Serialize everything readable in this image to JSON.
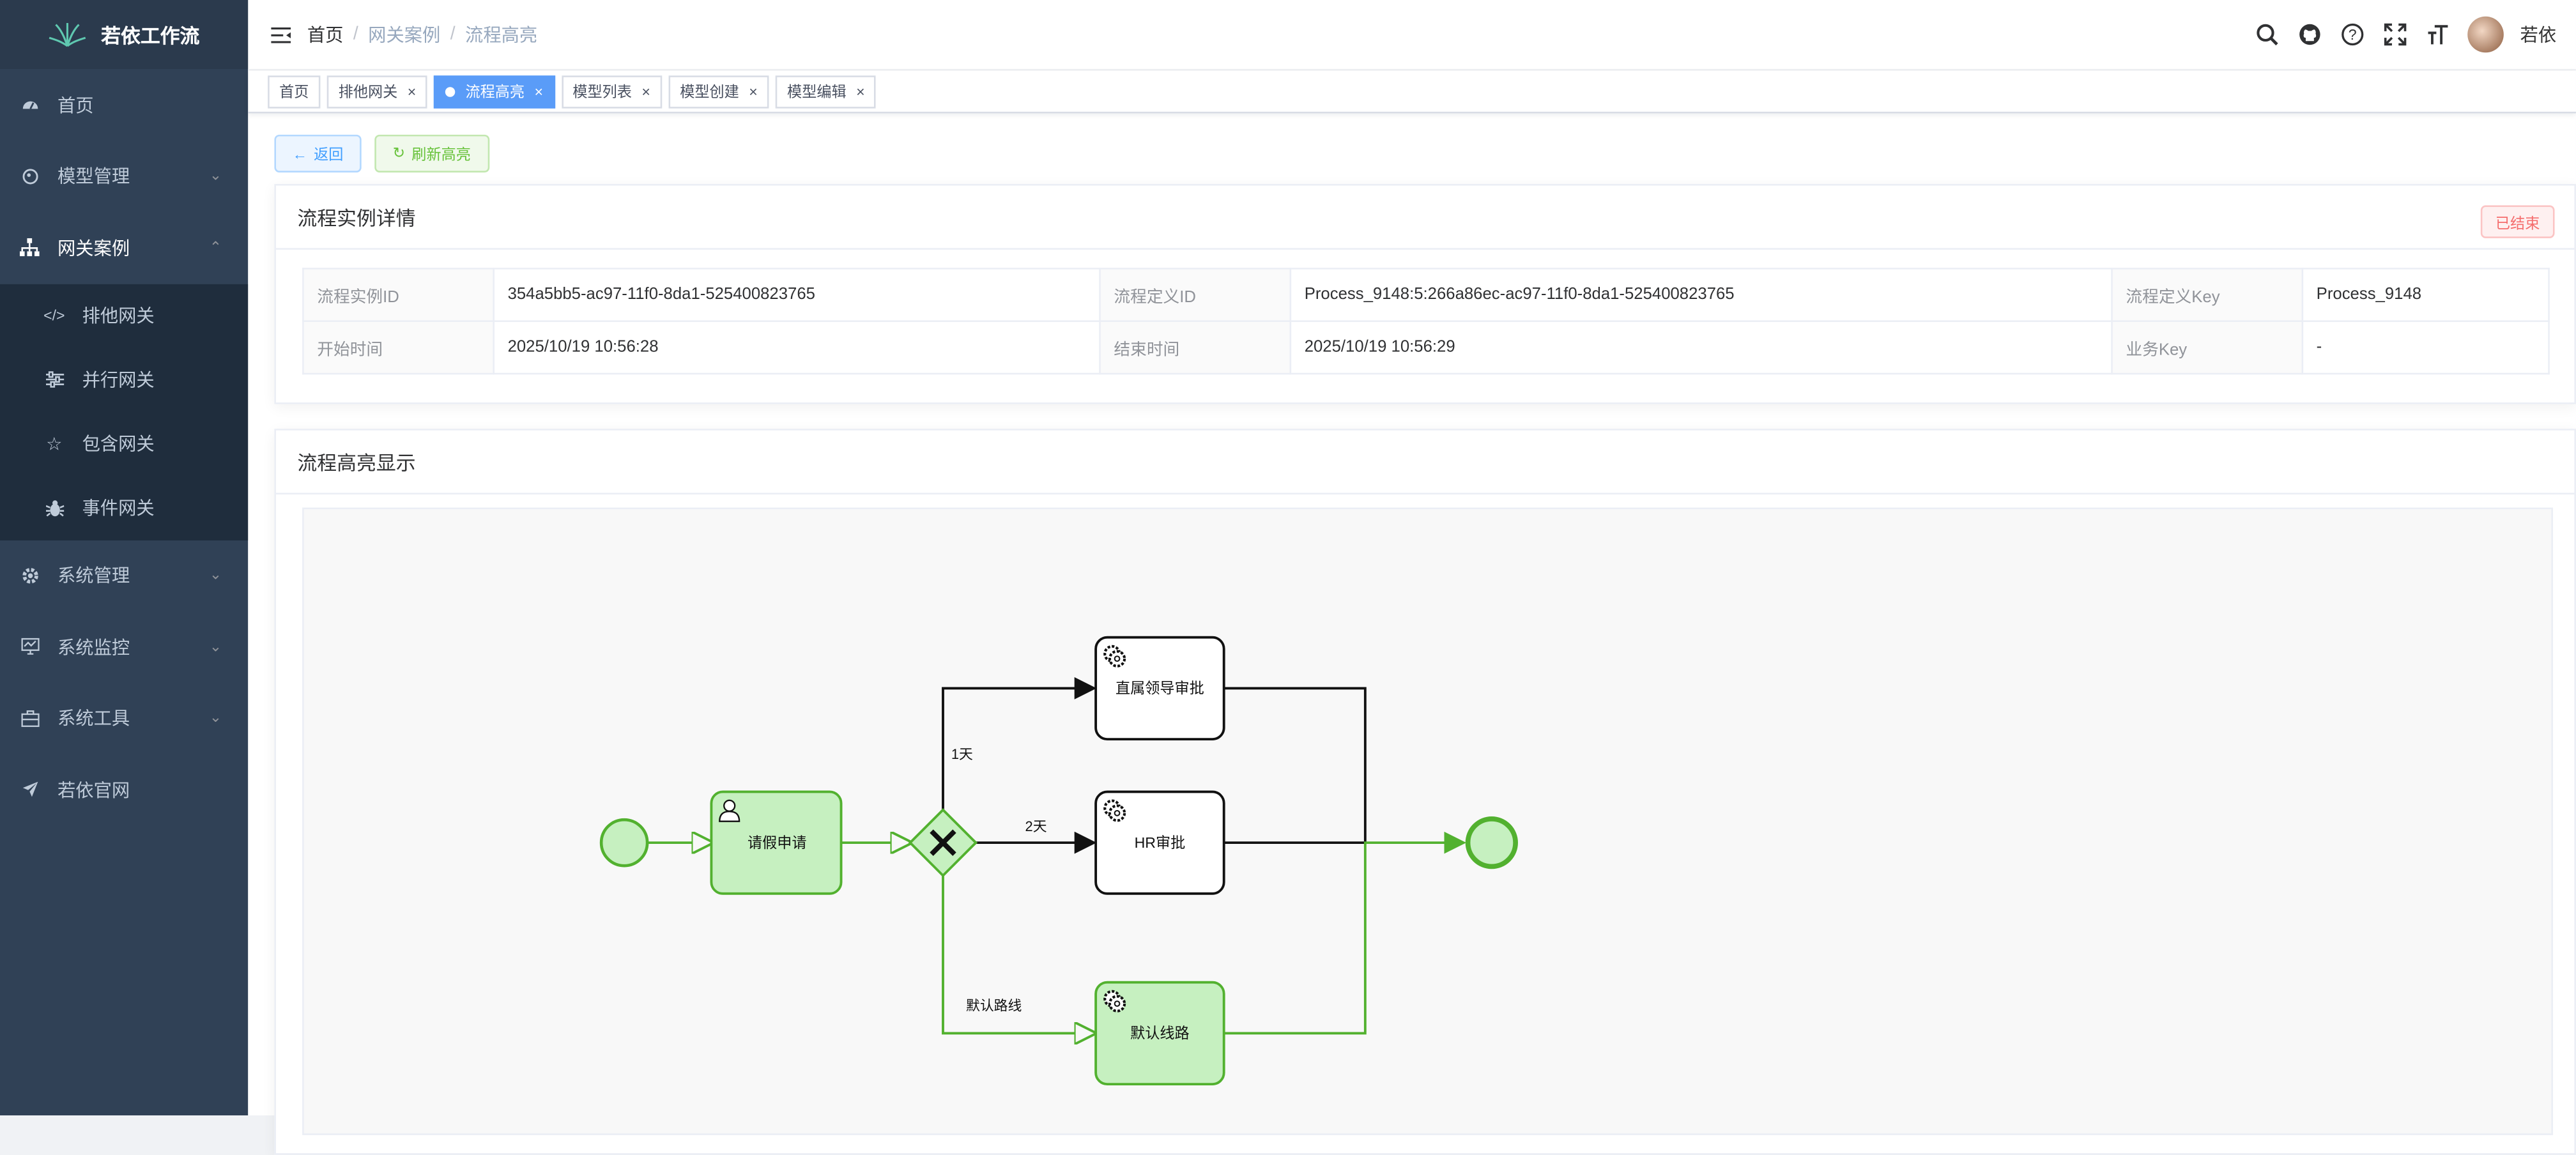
{
  "app": {
    "title": "若依工作流"
  },
  "sidebar": {
    "items": [
      {
        "label": "首页",
        "icon": "dashboard-icon"
      },
      {
        "label": "模型管理",
        "icon": "model-icon"
      },
      {
        "label": "网关案例",
        "icon": "tree-icon"
      },
      {
        "label": "系统管理",
        "icon": "gear-icon"
      },
      {
        "label": "系统监控",
        "icon": "monitor-icon"
      },
      {
        "label": "系统工具",
        "icon": "toolbox-icon"
      },
      {
        "label": "若依官网",
        "icon": "send-icon"
      }
    ],
    "submenu": [
      {
        "label": "排他网关",
        "icon": "code-icon"
      },
      {
        "label": "并行网关",
        "icon": "sliders-icon"
      },
      {
        "label": "包含网关",
        "icon": "star-icon"
      },
      {
        "label": "事件网关",
        "icon": "bug-icon"
      }
    ]
  },
  "breadcrumb": [
    "首页",
    "网关案例",
    "流程高亮"
  ],
  "user": {
    "name": "若依"
  },
  "tabs": [
    "首页",
    "排他网关",
    "流程高亮",
    "模型列表",
    "模型创建",
    "模型编辑"
  ],
  "buttons": {
    "back": "返回",
    "refresh": "刷新高亮"
  },
  "detail": {
    "title": "流程实例详情",
    "status": "已结束",
    "rows": [
      [
        "流程实例ID",
        "354a5bb5-ac97-11f0-8da1-525400823765",
        "流程定义ID",
        "Process_9148:5:266a86ec-ac97-11f0-8da1-525400823765",
        "流程定义Key",
        "Process_9148"
      ],
      [
        "开始时间",
        "2025/10/19 10:56:28",
        "结束时间",
        "2025/10/19 10:56:29",
        "业务Key",
        "-"
      ]
    ]
  },
  "diagram": {
    "title": "流程高亮显示",
    "tasks": {
      "apply": "请假申请",
      "leader": "直属领导审批",
      "hr": "HR审批",
      "default": "默认线路"
    },
    "flows": {
      "one_day": "1天",
      "two_day": "2天",
      "default_route": "默认路线"
    },
    "colors": {
      "done_fill": "#c6f0c0",
      "done_stroke": "#52b12f",
      "pending_stroke": "#111111"
    }
  }
}
